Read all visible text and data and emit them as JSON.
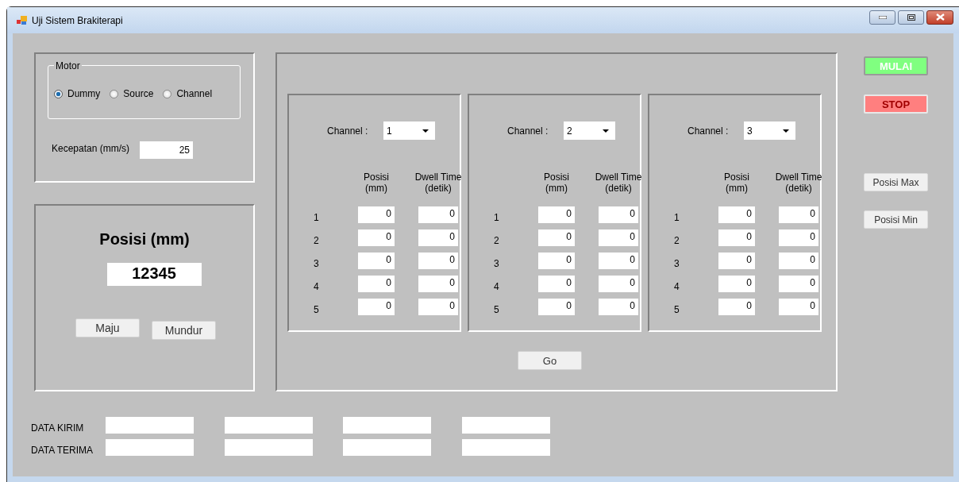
{
  "window": {
    "title": "Uji Sistem Brakiterapi"
  },
  "motor": {
    "legend": "Motor",
    "options": [
      {
        "label": "Dummy",
        "selected": true
      },
      {
        "label": "Source",
        "selected": false
      },
      {
        "label": "Channel",
        "selected": false
      }
    ]
  },
  "speed": {
    "label": "Kecepatan (mm/s)",
    "value": "25"
  },
  "position": {
    "title": "Posisi (mm)",
    "value": "12345",
    "buttons": [
      "Maju",
      "Mundur"
    ]
  },
  "channels": [
    {
      "label": "Channel :",
      "value": "1",
      "headers": [
        "Posisi\n(mm)",
        "Dwell Time\n(detik)"
      ],
      "rows": [
        {
          "number": "1",
          "posisi": "0",
          "dwell": "0"
        },
        {
          "number": "2",
          "posisi": "0",
          "dwell": "0"
        },
        {
          "number": "3",
          "posisi": "0",
          "dwell": "0"
        },
        {
          "number": "4",
          "posisi": "0",
          "dwell": "0"
        },
        {
          "number": "5",
          "posisi": "0",
          "dwell": "0"
        }
      ]
    },
    {
      "label": "Channel :",
      "value": "2",
      "headers": [
        "Posisi\n(mm)",
        "Dwell Time\n(detik)"
      ],
      "rows": [
        {
          "number": "1",
          "posisi": "0",
          "dwell": "0"
        },
        {
          "number": "2",
          "posisi": "0",
          "dwell": "0"
        },
        {
          "number": "3",
          "posisi": "0",
          "dwell": "0"
        },
        {
          "number": "4",
          "posisi": "0",
          "dwell": "0"
        },
        {
          "number": "5",
          "posisi": "0",
          "dwell": "0"
        }
      ]
    },
    {
      "label": "Channel :",
      "value": "3",
      "headers": [
        "Posisi\n(mm)",
        "Dwell Time\n(detik)"
      ],
      "rows": [
        {
          "number": "1",
          "posisi": "0",
          "dwell": "0"
        },
        {
          "number": "2",
          "posisi": "0",
          "dwell": "0"
        },
        {
          "number": "3",
          "posisi": "0",
          "dwell": "0"
        },
        {
          "number": "4",
          "posisi": "0",
          "dwell": "0"
        },
        {
          "number": "5",
          "posisi": "0",
          "dwell": "0"
        }
      ]
    }
  ],
  "go_button": "Go",
  "side_buttons": [
    {
      "label": "MULAI",
      "kind": "start"
    },
    {
      "label": "STOP",
      "kind": "stop"
    },
    {
      "label": "Posisi Max",
      "kind": "normal"
    },
    {
      "label": "Posisi Min",
      "kind": "normal"
    }
  ],
  "data_rows": [
    {
      "label": "DATA KIRIM",
      "fields": [
        {
          "kind": "text"
        },
        {
          "kind": "text"
        },
        {
          "kind": "text"
        },
        {
          "kind": "text"
        }
      ]
    },
    {
      "label": "DATA TERIMA",
      "fields": [
        {
          "kind": "text"
        },
        {
          "kind": "text"
        },
        {
          "kind": "text"
        },
        {
          "kind": "text"
        }
      ]
    }
  ]
}
